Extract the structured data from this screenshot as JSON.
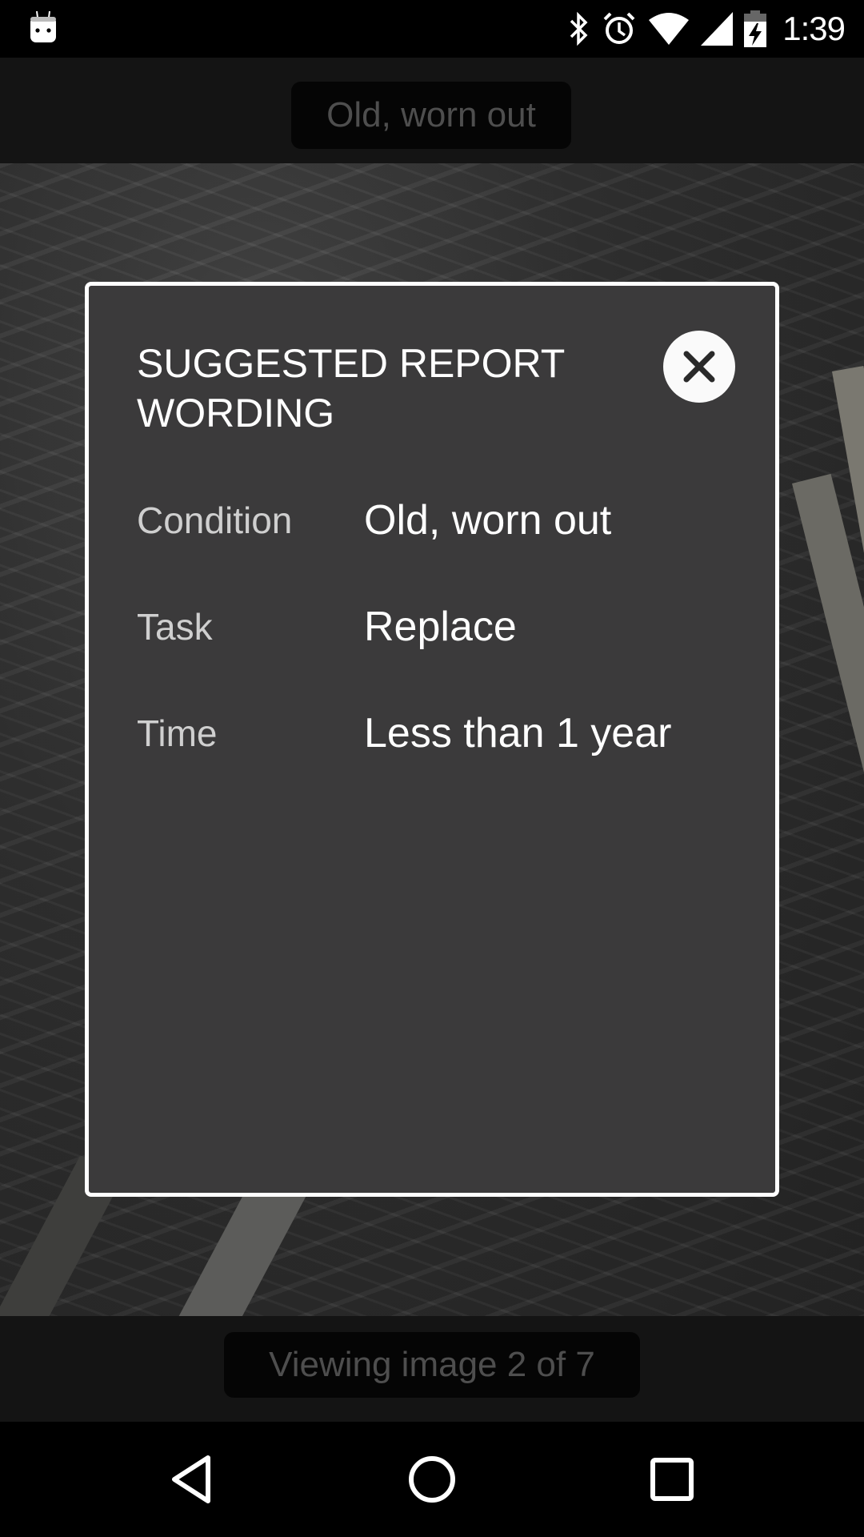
{
  "status_bar": {
    "time": "1:39",
    "icons": [
      "android-notification-icon",
      "bluetooth-icon",
      "alarm-icon",
      "wifi-icon",
      "cell-signal-icon",
      "battery-charging-icon"
    ]
  },
  "top_caption": "Old, worn out",
  "dialog": {
    "title": "SUGGESTED REPORT WORDING",
    "close_icon": "close-icon",
    "rows": [
      {
        "label": "Condition",
        "value": "Old, worn out"
      },
      {
        "label": "Task",
        "value": "Replace"
      },
      {
        "label": "Time",
        "value": "Less than 1 year"
      }
    ]
  },
  "bottom_caption": "Viewing image 2 of 7",
  "nav_bar": {
    "buttons": [
      "back-icon",
      "home-icon",
      "recents-icon"
    ]
  },
  "colors": {
    "dialog_bg": "#3b3a3b",
    "dialog_border": "#ffffff",
    "label_text": "#cfcfcf",
    "value_text": "#ffffff",
    "caption_text": "#4e4e4e"
  }
}
